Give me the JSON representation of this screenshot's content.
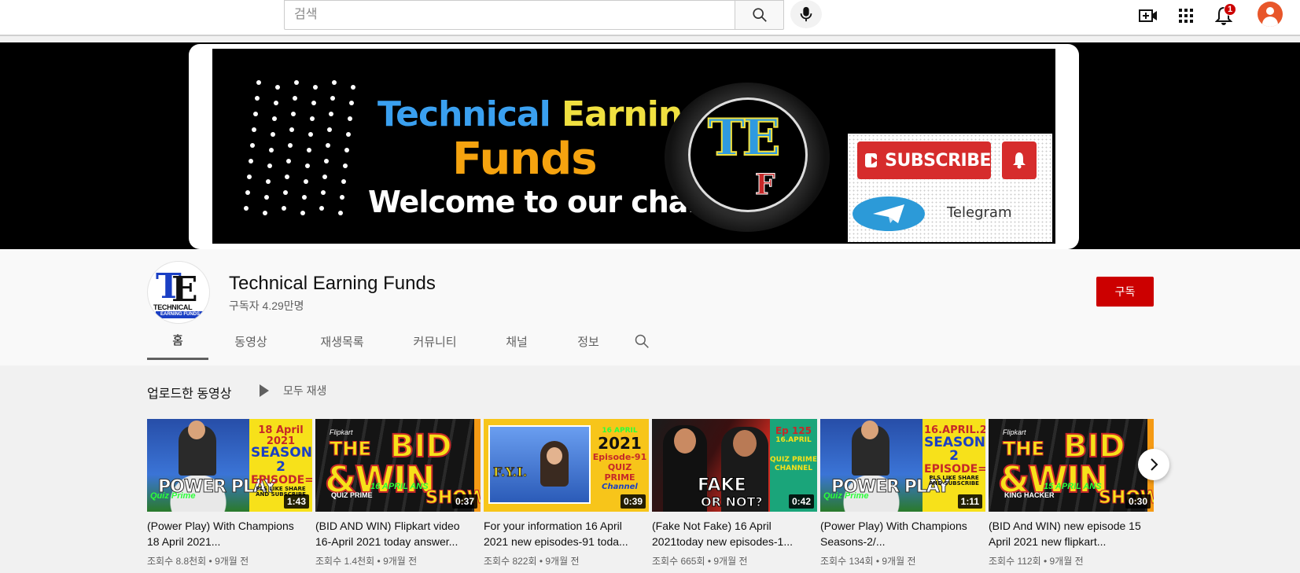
{
  "search": {
    "placeholder": "검색"
  },
  "top_bar": {
    "icons": [
      "search-icon",
      "mic-icon",
      "create-video-icon",
      "apps-icon",
      "notifications-icon",
      "account-avatar-icon"
    ],
    "notification_count": "1"
  },
  "banner": {
    "title_part1": "Technical",
    "title_part2": "Earning",
    "title_funds": "Funds",
    "welcome": "Welcome to our channel",
    "logo_text": "TE",
    "logo_f": "F",
    "subscribe_label": "SUBSCRIBE",
    "telegram_label": "Telegram"
  },
  "channel": {
    "name": "Technical Earning Funds",
    "subscribers": "구독자 4.29만명",
    "subscribe_button": "구독",
    "avatar_text_t": "T",
    "avatar_text_e": "E",
    "avatar_caption": "TECHNICAL",
    "avatar_caption2": "EARNING FUNDS"
  },
  "tabs": [
    {
      "label": "홈",
      "active": true
    },
    {
      "label": "동영상"
    },
    {
      "label": "재생목록"
    },
    {
      "label": "커뮤니티"
    },
    {
      "label": "채널"
    },
    {
      "label": "정보"
    }
  ],
  "shelf": {
    "title": "업로드한 동영상",
    "play_all": "모두 재생"
  },
  "thumb_text": {
    "pp1": {
      "main": "POWER PLAY",
      "s1": "18 April 2021",
      "s2": "SEASON-2",
      "s3": "EPISODE=10",
      "s4": "PLS LIKE SHARE AND SUBSCRIBE",
      "tag": "Quiz Prime"
    },
    "bw1": {
      "brand": "Flipkart",
      "the": "THE",
      "bid": "BID",
      "win": "&WIN",
      "show": "SHOW",
      "small": "QUIZ PRIME",
      "green": "16 APRIL ANS"
    },
    "fyi": {
      "fyi": "F.Y.I.",
      "d1": "16 APRIL",
      "d2": "2021",
      "d3": "Episode-91",
      "d4": "QUIZ PRIME",
      "d5": "Channel"
    },
    "fnf": {
      "fake": "FAKE",
      "not": "OR NOT?",
      "e1": "Ep 125",
      "e2": "16.APRIL",
      "e3": "QUIZ PRIME CHANNEL"
    },
    "pp2": {
      "main": "POWER PLAY",
      "s1": "16.APRIL.2021",
      "s2": "SEASON 2",
      "s3": "EPISODE=8",
      "s4": "PLS LIKE SHARE AND SUBSCRIBE",
      "tag": "Quiz Prime"
    },
    "bw2": {
      "brand": "Flipkart",
      "the": "THE",
      "bid": "BID",
      "win": "&WIN",
      "show": "SHOW",
      "small": "KING HACKER",
      "green": "15 APRIL ANS"
    }
  },
  "videos": [
    {
      "title": "(Power Play) With Champions 18 April 2021...",
      "duration": "1:43",
      "meta": "조회수 8.8천회 • 9개월 전"
    },
    {
      "title": "(BID AND WIN) Flipkart video 16-April 2021 today answer...",
      "duration": "0:37",
      "meta": "조회수 1.4천회 • 9개월 전"
    },
    {
      "title": "For your information 16 April 2021 new episodes-91 toda...",
      "duration": "0:39",
      "meta": "조회수 822회 • 9개월 전"
    },
    {
      "title": "(Fake Not Fake) 16 April 2021today new episodes-1...",
      "duration": "0:42",
      "meta": "조회수 665회 • 9개월 전"
    },
    {
      "title": "(Power Play) With Champions Seasons-2/...",
      "duration": "1:11",
      "meta": "조회수 134회 • 9개월 전"
    },
    {
      "title": "(BID And WIN) new episode 15 April 2021 new flipkart...",
      "duration": "0:30",
      "meta": "조회수 112회 • 9개월 전"
    }
  ],
  "colors": {
    "subscribe_red": "#cc0000",
    "banner_blue": "#3aa0f0",
    "banner_yellow": "#f0e040",
    "banner_orange": "#f5a30f"
  }
}
